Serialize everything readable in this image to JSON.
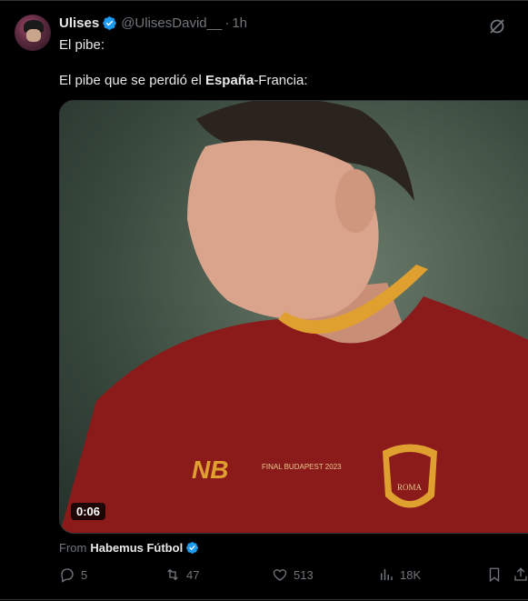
{
  "tweet": {
    "author_name": "Ulises",
    "author_handle": "@UlisesDavid__",
    "separator": "·",
    "time": "1h",
    "line1": "El pibe:",
    "line2_pre": "El pibe que se perdió el ",
    "line2_bold": "España",
    "line2_post": "-Francia:",
    "video_duration": "0:06",
    "from_label": "From",
    "from_source": "Habemus Fútbol",
    "shirt_text": "FINAL BUDAPEST 2023",
    "badge_text": "ROMA"
  },
  "actions": {
    "replies": "5",
    "reposts": "47",
    "likes": "513",
    "views": "18K"
  },
  "colors": {
    "background": "#000000",
    "verified": "#1d9bf0",
    "muted": "#71767b",
    "jersey": "#8b1a1a",
    "collar": "#e0a030"
  }
}
